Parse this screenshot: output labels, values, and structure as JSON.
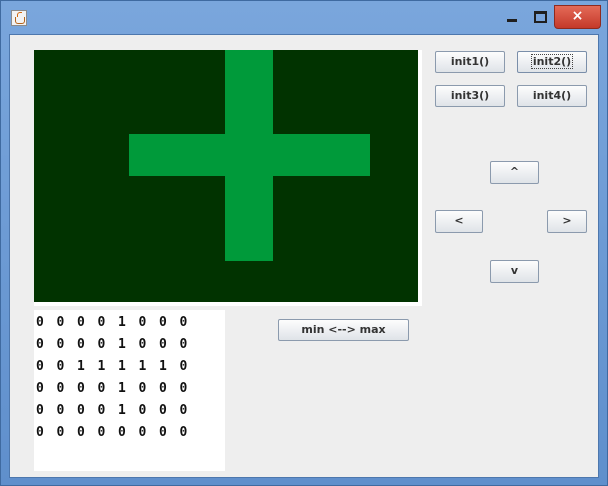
{
  "window": {
    "close_glyph": "×"
  },
  "buttons": {
    "init1": "init1()",
    "init2": "init2()",
    "init3": "init3()",
    "init4": "init4()",
    "up": "^",
    "left": "<",
    "right": ">",
    "down": "v",
    "min_max": "min <--> max"
  },
  "canvas": {
    "background_color": "#013300",
    "shape_color": "#009a3a",
    "shape": "plus-cross"
  },
  "matrix": [
    [
      "0",
      "0",
      "0",
      "0",
      "1",
      "0",
      "0",
      "0"
    ],
    [
      "0",
      "0",
      "0",
      "0",
      "1",
      "0",
      "0",
      "0"
    ],
    [
      "0",
      "0",
      "1",
      "1",
      "1",
      "1",
      "1",
      "0"
    ],
    [
      "0",
      "0",
      "0",
      "0",
      "1",
      "0",
      "0",
      "0"
    ],
    [
      "0",
      "0",
      "0",
      "0",
      "1",
      "0",
      "0",
      "0"
    ],
    [
      "0",
      "0",
      "0",
      "0",
      "0",
      "0",
      "0",
      "0"
    ]
  ]
}
